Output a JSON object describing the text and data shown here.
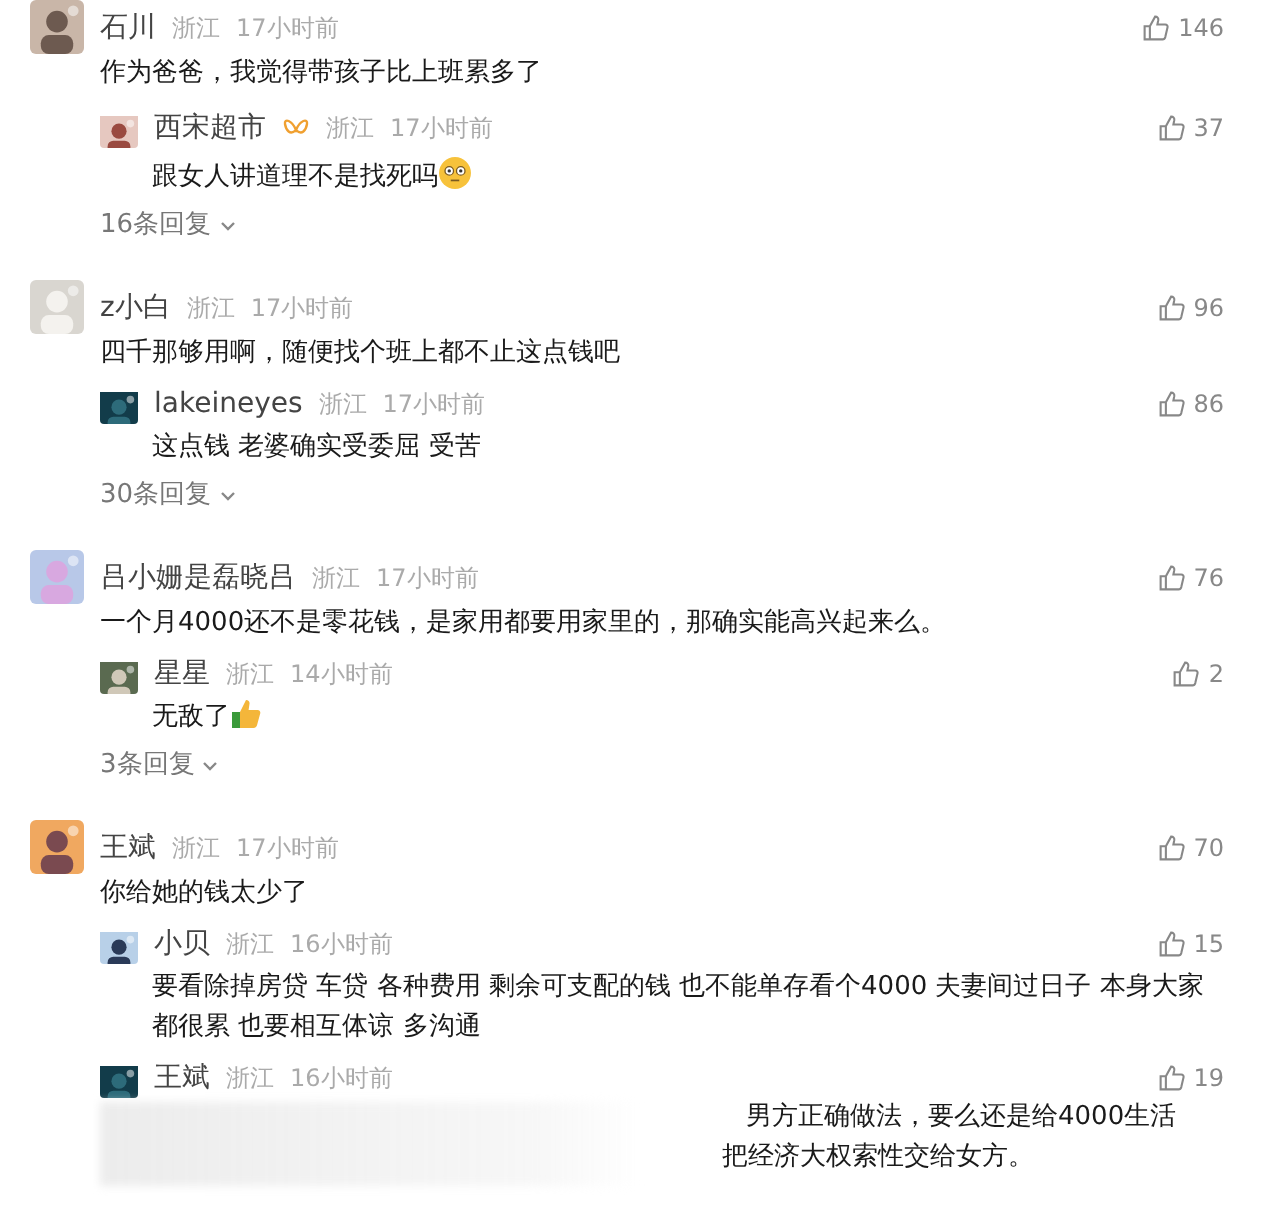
{
  "comments": [
    {
      "user": "石川",
      "location": "浙江",
      "time": "17小时前",
      "likes": "146",
      "text": "作为爸爸，我觉得带孩子比上班累多了",
      "replies": [
        {
          "user": "西宋超市",
          "badge": true,
          "location": "浙江",
          "time": "17小时前",
          "likes": "37",
          "text": "跟女人讲道理不是找死吗",
          "kind": "flushed-emoji"
        }
      ],
      "more": "16条回复"
    },
    {
      "user": "z小白",
      "location": "浙江",
      "time": "17小时前",
      "likes": "96",
      "text": "四千那够用啊，随便找个班上都不止这点钱吧",
      "replies": [
        {
          "user": "lakeineyes",
          "badge": false,
          "location": "浙江",
          "time": "17小时前",
          "likes": "86",
          "text": "这点钱 老婆确实受委屈 受苦"
        }
      ],
      "more": "30条回复"
    },
    {
      "user": "吕小姗是磊晓吕",
      "location": "浙江",
      "time": "17小时前",
      "likes": "76",
      "text": "一个月4000还不是零花钱，是家用都要用家里的，那确实能高兴起来么。",
      "replies": [
        {
          "user": "星星",
          "badge": false,
          "location": "浙江",
          "time": "14小时前",
          "likes": "2",
          "text": "无敌了",
          "kind": "thumbs-up-emoji"
        }
      ],
      "more": "3条回复"
    },
    {
      "user": "王斌",
      "location": "浙江",
      "time": "17小时前",
      "likes": "70",
      "text": "你给她的钱太少了",
      "replies": [
        {
          "user": "小贝",
          "badge": false,
          "location": "浙江",
          "time": "16小时前",
          "likes": "15",
          "text": "要看除掉房贷 车贷 各种费用 剩余可支配的钱 也不能单存看个4000 夫妻间过日子 本身大家都很累 也要相互体谅 多沟通"
        },
        {
          "user": "王斌",
          "badge": false,
          "location": "浙江",
          "time": "16小时前",
          "likes": "19",
          "obscured": true,
          "lines": [
            "男方正确做法，要么还是给4000生活",
            "把经济大权索性交给女方。"
          ]
        }
      ]
    }
  ]
}
